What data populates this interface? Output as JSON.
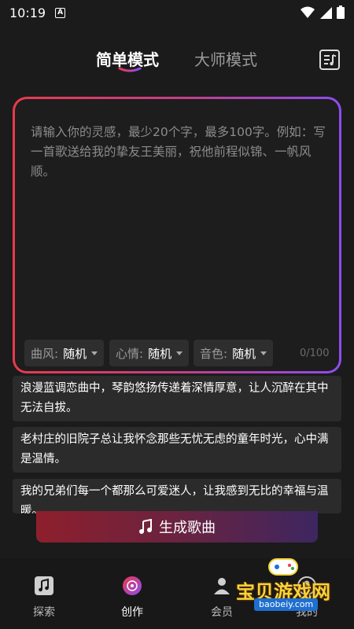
{
  "status_bar": {
    "time": "10:19",
    "notification_badge": "A"
  },
  "header": {
    "tabs": [
      {
        "label": "简单模式",
        "active": true
      },
      {
        "label": "大师模式",
        "active": false
      }
    ],
    "accent_gradient": [
      "#e83a4e",
      "#8e4cf0"
    ],
    "right_icon": "music-list-icon"
  },
  "input": {
    "placeholder": "请输入你的灵感，最少20个字，最多100字。例如：写一首歌送给我的挚友王美丽，祝他前程似锦、一帆风顺。",
    "value": "",
    "counter": "0/100",
    "options": [
      {
        "label": "曲风:",
        "value": "随机"
      },
      {
        "label": "心情:",
        "value": "随机"
      },
      {
        "label": "音色:",
        "value": "随机"
      }
    ]
  },
  "suggestions": [
    "浪漫蓝调恋曲中，琴韵悠扬传递着深情厚意，让人沉醉在其中无法自拔。",
    "老村庄的旧院子总让我怀念那些无忧无虑的童年时光，心中满是温情。",
    "我的兄弟们每一个都那么可爱迷人，让我感到无比的幸福与温暖。"
  ],
  "generate_button": {
    "label": "生成歌曲",
    "icon": "music-note-icon"
  },
  "bottom_nav": [
    {
      "label": "探索",
      "icon": "music-tile-icon",
      "active": false
    },
    {
      "label": "创作",
      "icon": "disc-icon",
      "active": true
    },
    {
      "label": "会员",
      "icon": "member-icon",
      "active": false
    },
    {
      "label": "我的",
      "icon": "profile-icon",
      "active": false
    }
  ],
  "watermark": {
    "text": "宝贝游戏网",
    "url": "baobeiy.com"
  }
}
